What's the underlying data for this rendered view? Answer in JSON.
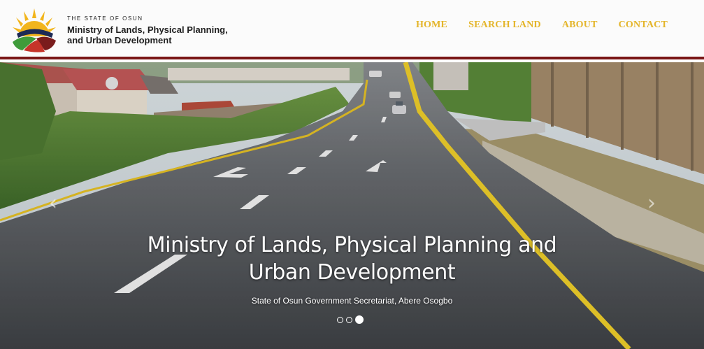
{
  "brand": {
    "state": "THE STATE OF OSUN",
    "title_line1": "Ministry of Lands, Physical Planning,",
    "title_line2": "and Urban Development",
    "logo_icon": "osun-sun-logo-icon"
  },
  "nav": [
    {
      "label": "HOME"
    },
    {
      "label": "SEARCH LAND"
    },
    {
      "label": "ABOUT"
    },
    {
      "label": "CONTACT"
    }
  ],
  "hero": {
    "title_line1": "Ministry of Lands, Physical Planning and",
    "title_line2": "Urban Development",
    "subtitle": "State of Osun Government Secretariat, Abere Osogbo",
    "prev_icon": "chevron-left-icon",
    "next_icon": "chevron-right-icon",
    "slides_total": 3,
    "slide_active": 3
  },
  "colors": {
    "nav_accent": "#e4b52a",
    "header_border": "#7a1717"
  }
}
